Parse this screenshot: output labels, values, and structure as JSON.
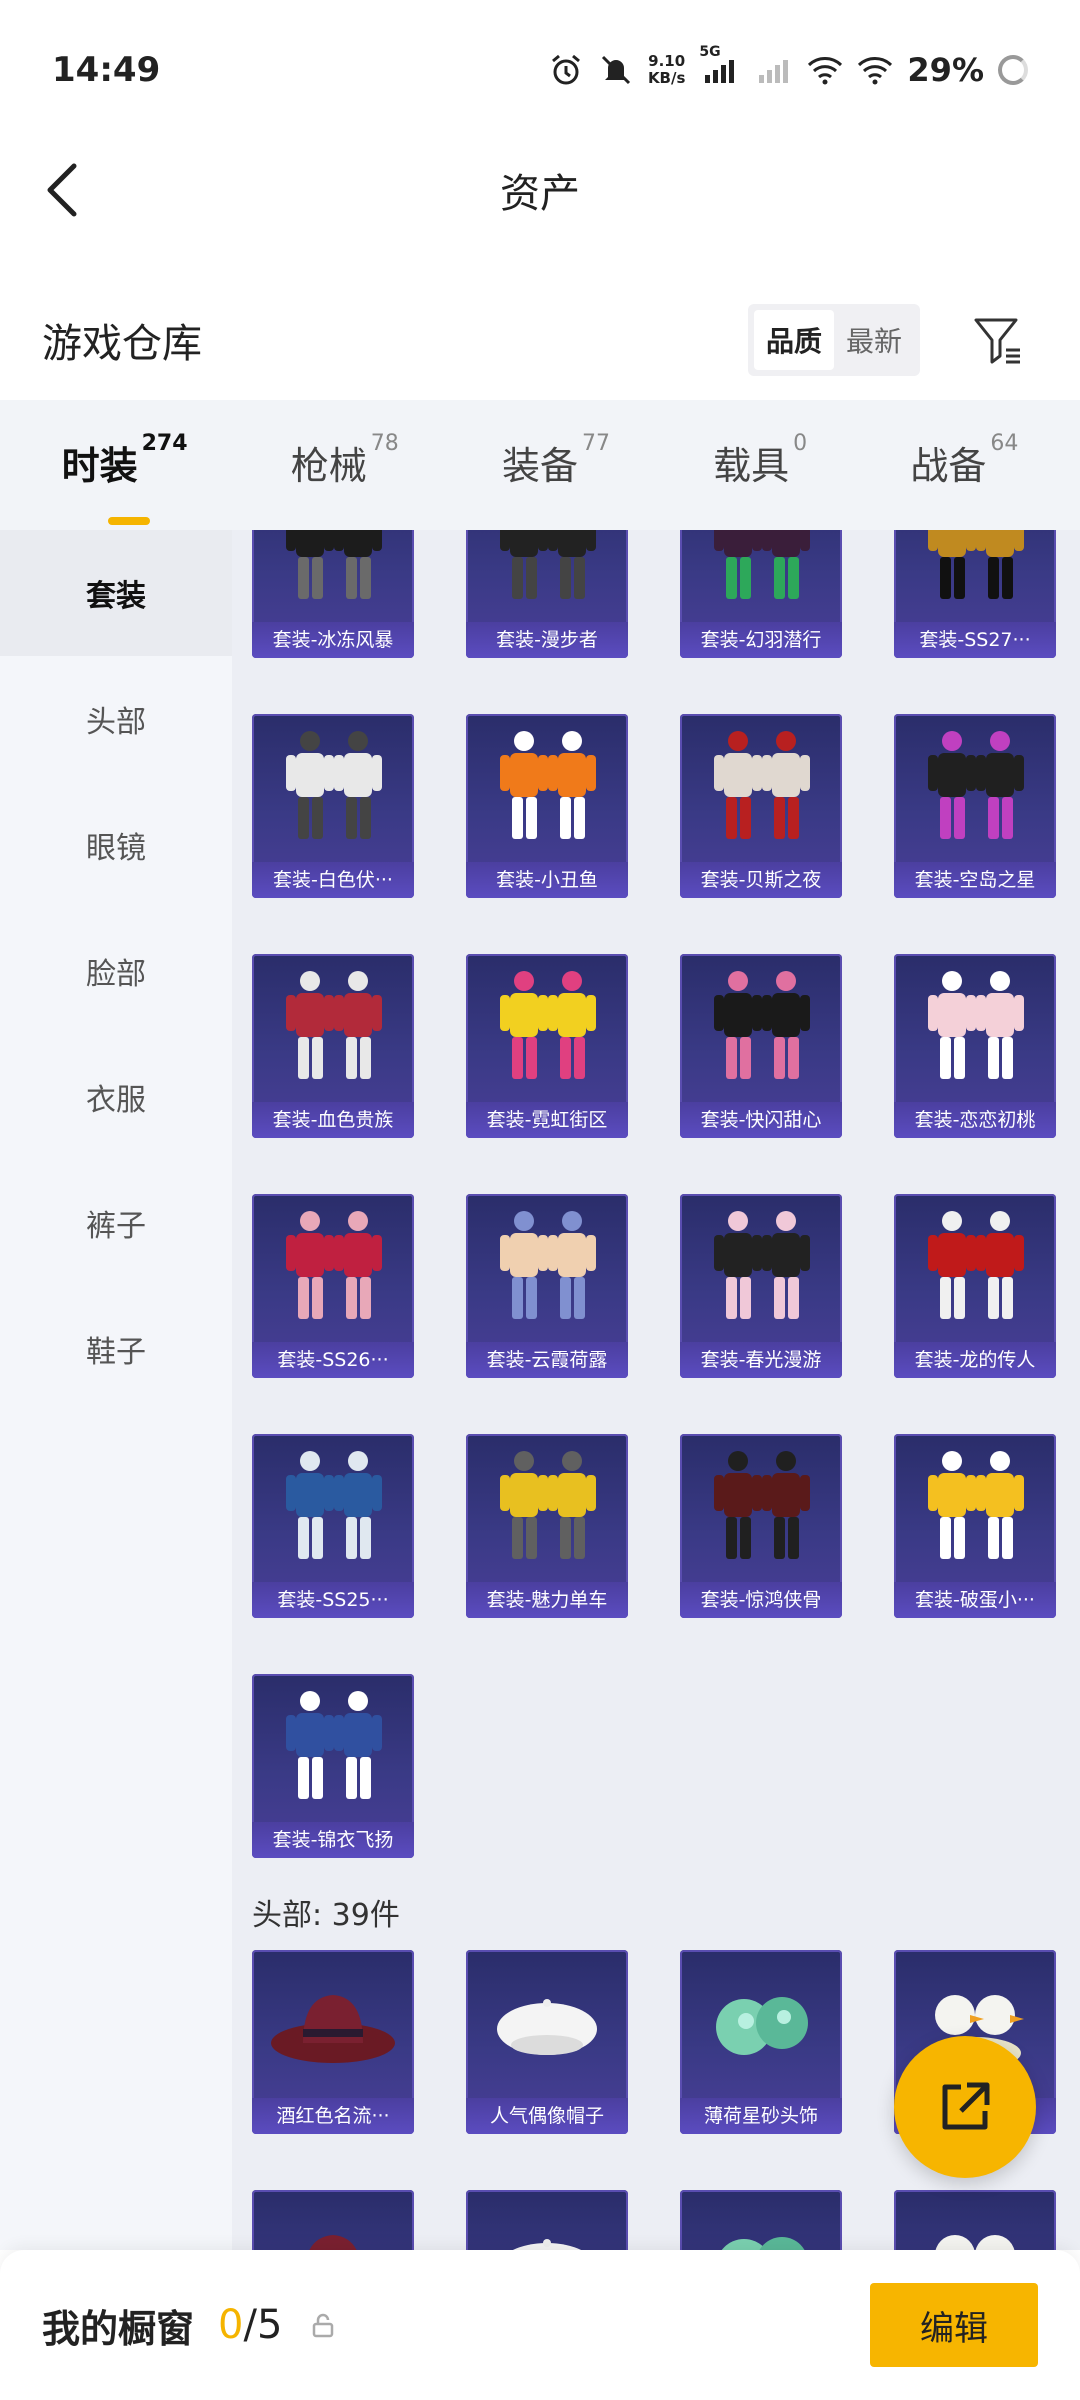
{
  "status_bar": {
    "time": "14:49",
    "net_speed_value": "9.10",
    "net_speed_unit": "KB/s",
    "network_type": "5G",
    "battery": "29%",
    "icons": [
      "alarm-icon",
      "mute-icon",
      "signal-icon",
      "signal-weak-icon",
      "wifi-icon",
      "wifi-icon",
      "battery-ring-icon"
    ]
  },
  "header": {
    "title": "资产",
    "back_icon": "chevron-left-icon"
  },
  "warehouse": {
    "title": "游戏仓库",
    "sort_options": [
      "品质",
      "最新"
    ],
    "sort_selected": "品质",
    "filter_icon": "filter-icon"
  },
  "tabs": [
    {
      "label": "时装",
      "count": "274",
      "active": true
    },
    {
      "label": "枪械",
      "count": "78",
      "active": false
    },
    {
      "label": "装备",
      "count": "77",
      "active": false
    },
    {
      "label": "载具",
      "count": "0",
      "active": false
    },
    {
      "label": "战备",
      "count": "64",
      "active": false
    }
  ],
  "sidebar": {
    "items": [
      "套装",
      "头部",
      "眼镜",
      "脸部",
      "衣服",
      "裤子",
      "鞋子"
    ],
    "active": "套装"
  },
  "suits": {
    "items": [
      "套装-冰冻风暴",
      "套装-漫步者",
      "套装-幻羽潜行",
      "套装-SS27···",
      "套装-白色伏···",
      "套装-小丑鱼",
      "套装-贝斯之夜",
      "套装-空岛之星",
      "套装-血色贵族",
      "套装-霓虹街区",
      "套装-快闪甜心",
      "套装-恋恋初桃",
      "套装-SS26···",
      "套装-云霞荷露",
      "套装-春光漫游",
      "套装-龙的传人",
      "套装-SS25···",
      "套装-魅力单车",
      "套装-惊鸿侠骨",
      "套装-破蛋小···",
      "套装-锦衣飞扬"
    ]
  },
  "head_section": {
    "title": "头部: 39件",
    "items": [
      "酒红色名流···",
      "人气偶像帽子",
      "薄荷星砂头饰",
      ""
    ]
  },
  "fab": {
    "icon": "share-out-icon"
  },
  "bottom_bar": {
    "title": "我的橱窗",
    "count_current": "0",
    "count_total": "/5",
    "lock_icon": "lock-icon",
    "edit_label": "编辑"
  },
  "colors": {
    "accent": "#f7b500",
    "card_bg": "#3a3a86",
    "card_label": "#5b4cc0"
  }
}
